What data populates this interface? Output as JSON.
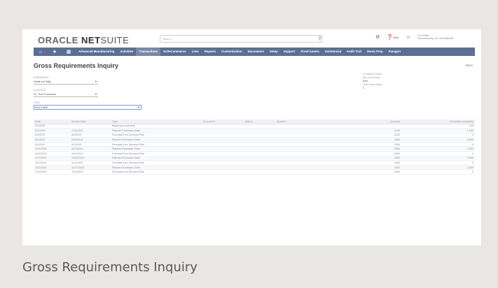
{
  "topbar": {
    "logo_oracle": "ORACLE",
    "logo_net": "NET",
    "logo_suite": "SUITE",
    "search_placeholder": "Search",
    "help_label": "Help",
    "user_name": "Eric Wallin",
    "user_role": "Manufacturing, Inc. Administrator"
  },
  "nav": {
    "items": [
      "Advanced Manufacturing",
      "Activities",
      "Transactions",
      "SuiteCommerce",
      "Lists",
      "Reports",
      "Customization",
      "Documents",
      "Setup",
      "Support",
      "Fixed Assets",
      "SuiteSocial",
      "Audit Trail",
      "Demo Prep",
      "Paragon"
    ],
    "active_index": 2
  },
  "page": {
    "title": "Gross Requirements Inquiry",
    "more": "More"
  },
  "form": {
    "subsidiary_label": "Subsidiary *",
    "subsidiary_value": "Wolfe Inc Mfg",
    "location_label": "Location",
    "location_value": "01: San Francisco",
    "item_label": "Item",
    "item_value": "MACHINE",
    "include_label": "Include Orders",
    "net_label": "Net of Inventory",
    "net_value": "Both",
    "lead_label": "Lead Time (Days)",
    "lead_value": "0"
  },
  "table": {
    "headers": [
      "Date",
      "Source Date",
      "Type",
      "Document",
      "Status",
      "Number",
      "Quantity",
      "Cumulative Available"
    ],
    "rows": [
      [
        "8/1/2019",
        "",
        "Beginning Inventory",
        "",
        "",
        "",
        "",
        "100"
      ],
      [
        "8/1/2019",
        "7/31/2019",
        "Planned Purchase Order",
        "",
        "",
        "",
        "1000",
        "1,100"
      ],
      [
        "8/1/2019",
        "8/1/2019",
        "Forecast from Demand Plan",
        "",
        "",
        "",
        "-1100",
        "0"
      ],
      [
        "8/1/2019",
        "8/30/2019",
        "Planned Purchase Order",
        "",
        "",
        "",
        "2000",
        "2,000"
      ],
      [
        "9/1/2019",
        "9/1/2019",
        "Forecast from Demand Plan",
        "",
        "",
        "",
        "-2000",
        "0"
      ],
      [
        "10/1/2019",
        "9/27/2019",
        "Planned Purchase Order",
        "",
        "",
        "",
        "2000",
        "2,000"
      ],
      [
        "10/1/2019",
        "10/1/2019",
        "Forecast from Demand Plan",
        "",
        "",
        "",
        "-2000",
        "0"
      ],
      [
        "11/1/2019",
        "10/30/2019",
        "Planned Purchase Order",
        "",
        "",
        "",
        "2000",
        "2,000"
      ],
      [
        "11/1/2019",
        "11/1/2019",
        "Forecast from Demand Plan",
        "",
        "",
        "",
        "-2000",
        "0"
      ],
      [
        "12/1/2019",
        "11/27/2019",
        "Planned Purchase Order",
        "",
        "",
        "",
        "2000",
        "2,000"
      ],
      [
        "12/1/2019",
        "12/1/2019",
        "Forecast from Demand Plan",
        "",
        "",
        "",
        "-2000",
        "0"
      ]
    ]
  },
  "caption": "Gross Requirements Inquiry"
}
